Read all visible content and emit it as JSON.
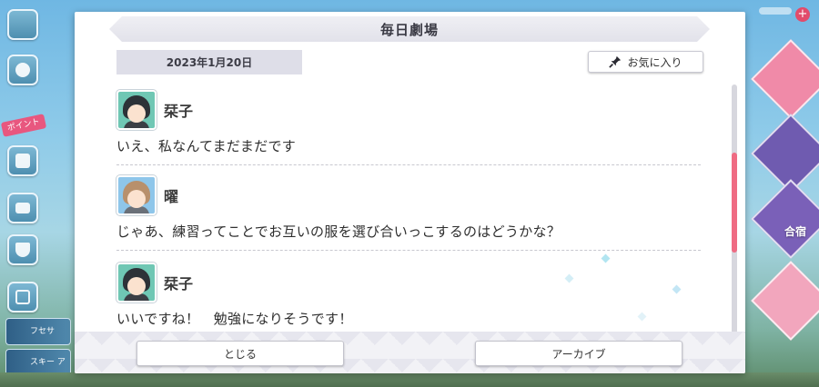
{
  "background": {
    "left_menu": {
      "menu_icon": "hamburger-icon",
      "buttons": [
        "speech-icon",
        "present-icon",
        "gift-icon",
        "monitor-icon",
        "trophy-icon",
        "fullscreen-icon"
      ],
      "tag_label": "ポイント",
      "cards": [
        "フセサ",
        "スキー アイテ"
      ]
    },
    "right_menu": {
      "plus_label": "+",
      "gouka_label": "合宿"
    }
  },
  "modal": {
    "title": "毎日劇場",
    "date": "2023年1月20日",
    "favorite_label": "お気に入り",
    "favorite_icon": "pin-icon",
    "messages": [
      {
        "speaker": "栞子",
        "avatar": "green",
        "text": "いえ、私なんてまだまだです"
      },
      {
        "speaker": "曜",
        "avatar": "blue",
        "text": "じゃあ、練習ってことでお互いの服を選び合いっこするのはどうかな？"
      },
      {
        "speaker": "栞子",
        "avatar": "green",
        "text": "いいですね！　勉強になりそうです！"
      }
    ],
    "scroll_position": 0.45,
    "close_label": "とじる",
    "archive_label": "アーカイブ"
  },
  "colors": {
    "accent_pink": "#ef6b83",
    "sky": "#8fcbe9",
    "chip": "#dedee8"
  }
}
